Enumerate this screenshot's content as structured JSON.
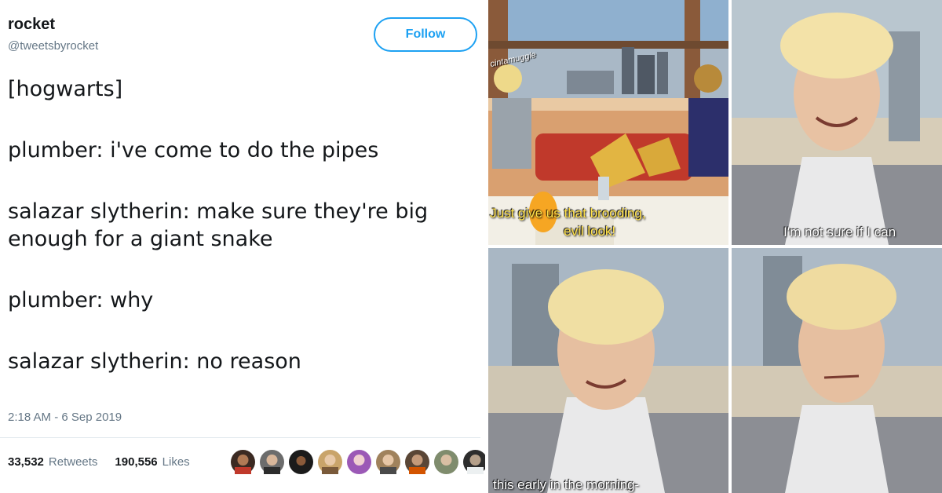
{
  "tweet": {
    "display_name": "rocket",
    "handle": "@tweetsbyrocket",
    "follow_label": "Follow",
    "lines": [
      "[hogwarts]",
      "plumber: i've come to do the pipes",
      "salazar slytherin: make sure they're big enough for a giant snake",
      "plumber: why",
      "salazar slytherin: no reason"
    ],
    "timestamp": "2:18 AM - 6 Sep 2019",
    "retweets_count": "33,532",
    "retweets_label": "Retweets",
    "likes_count": "190,556",
    "likes_label": "Likes"
  },
  "meme": {
    "watermark": "cintamuggle",
    "caption_1a": "Just give us that brooding,",
    "caption_1b": "evil look!",
    "caption_2": "I'm not sure if I can",
    "caption_3": "this early in the morning-"
  },
  "colors": {
    "accent": "#1da1f2",
    "text": "#14171a",
    "muted": "#657786"
  }
}
